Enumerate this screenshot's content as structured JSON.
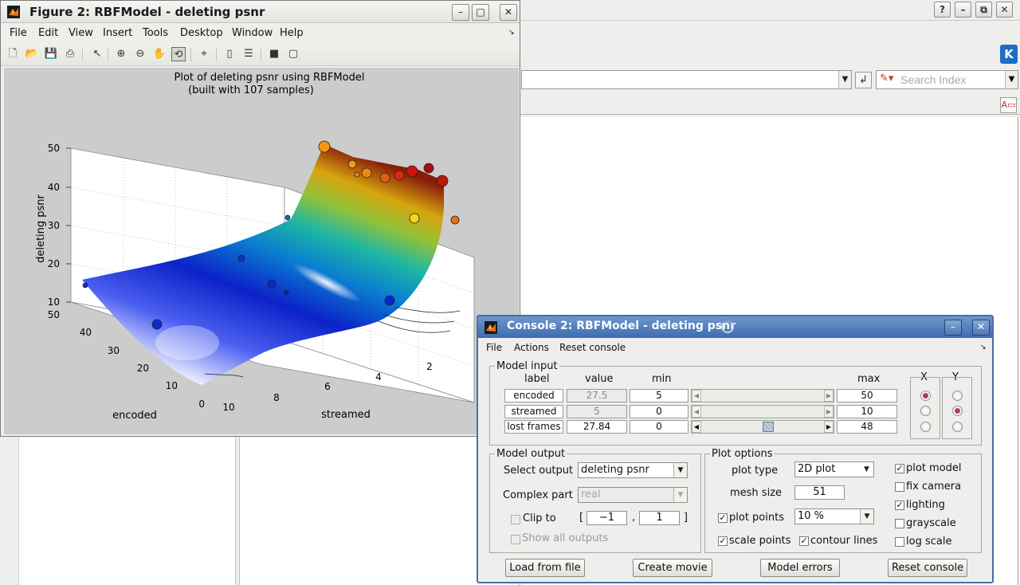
{
  "background_window": {
    "buttons": {
      "help": "?",
      "minimize": "–",
      "restore": "⧉",
      "close": "✕"
    },
    "search": {
      "placeholder": "Search Index"
    }
  },
  "figure": {
    "title": "Figure 2: RBFModel - deleting psnr",
    "buttons": {
      "minimize": "–",
      "maximize": "□",
      "close": "✕"
    },
    "menu": [
      "File",
      "Edit",
      "View",
      "Insert",
      "Tools",
      "Desktop",
      "Window",
      "Help"
    ],
    "toolbar": [
      "new-file",
      "open-file",
      "save",
      "print",
      "select-arrow",
      "zoom-in",
      "zoom-out",
      "pan-hand",
      "rotate-3d",
      "data-cursor",
      "colorbar",
      "legend",
      "hide-plot-tools",
      "show-plot-tools"
    ],
    "plot": {
      "title_line1": "Plot of deleting psnr using RBFModel",
      "title_line2": "(built with 107 samples)",
      "zlabel": "deleting psnr",
      "xlabel": "encoded",
      "ylabel": "streamed",
      "z_ticks": [
        "50",
        "40",
        "30",
        "20",
        "10"
      ],
      "encoded_ticks": [
        "50",
        "40",
        "30",
        "20",
        "10",
        "0"
      ],
      "streamed_ticks": [
        "10",
        "8",
        "6",
        "4",
        "2"
      ]
    }
  },
  "console": {
    "title": "Console 2: RBFModel - deleting psnr",
    "buttons": {
      "minimize": "–",
      "close": "✕"
    },
    "menu": [
      "File",
      "Actions",
      "Reset console"
    ],
    "model_input": {
      "legend": "Model input",
      "headers": {
        "label": "label",
        "value": "value",
        "min": "min",
        "max": "max",
        "x": "X",
        "y": "Y"
      },
      "rows": [
        {
          "label": "encoded",
          "value": "27.5",
          "min": "5",
          "max": "50",
          "x": true,
          "y": false,
          "slider": 0.5
        },
        {
          "label": "streamed",
          "value": "5",
          "min": "0",
          "max": "10",
          "x": false,
          "y": true,
          "slider": 0.5
        },
        {
          "label": "lost frames",
          "value": "27.84",
          "min": "0",
          "max": "48",
          "x": false,
          "y": false,
          "slider": 0.58
        }
      ]
    },
    "model_output": {
      "legend": "Model output",
      "select_output_label": "Select output",
      "select_output_value": "deleting psnr",
      "complex_part_label": "Complex part",
      "complex_part_value": "real",
      "clip_to_label": "Clip to",
      "clip_bracket_open": "[",
      "clip_min": "−1",
      "clip_sep": ",",
      "clip_max": "1",
      "clip_bracket_close": "]",
      "show_all_outputs_label": "Show all outputs"
    },
    "plot_options": {
      "legend": "Plot options",
      "plot_type_label": "plot type",
      "plot_type_value": "2D plot",
      "mesh_size_label": "mesh size",
      "mesh_size_value": "51",
      "plot_points_label": "plot points",
      "plot_points_value": "10 %",
      "scale_points_label": "scale points",
      "contour_lines_label": "contour lines",
      "checks": {
        "plot_model": {
          "label": "plot model",
          "checked": true
        },
        "fix_camera": {
          "label": "fix camera",
          "checked": false
        },
        "lighting": {
          "label": "lighting",
          "checked": true
        },
        "grayscale": {
          "label": "grayscale",
          "checked": false
        },
        "log_scale": {
          "label": "log scale",
          "checked": false
        },
        "plot_points": {
          "checked": true
        },
        "scale_points": {
          "checked": true
        },
        "contour_lines": {
          "checked": true
        }
      }
    },
    "buttons_row": {
      "load_from_file": "Load from file",
      "create_movie": "Create movie",
      "model_errors": "Model errors",
      "reset_console": "Reset console"
    }
  }
}
